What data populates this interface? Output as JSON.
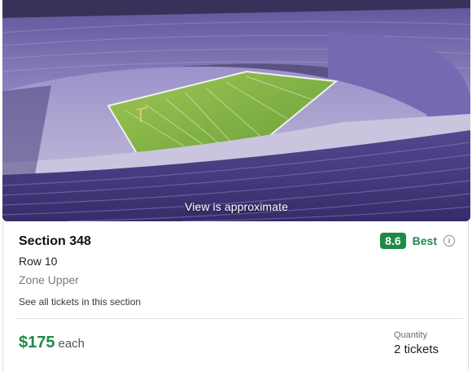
{
  "view": {
    "caption": "View is approximate"
  },
  "listing": {
    "section": "Section 348",
    "row": "Row 10",
    "zone": "Zone Upper",
    "see_all": "See all tickets in this section",
    "rating_score": "8.6",
    "rating_label": "Best",
    "price": "$175",
    "price_unit": "each",
    "quantity_label": "Quantity",
    "quantity_value": "2 tickets"
  },
  "colors": {
    "accent_green": "#1e8a46",
    "seat_purple": "#6e5fb0",
    "field_green": "#8fc24a"
  },
  "icons": {
    "info": "info-icon"
  }
}
